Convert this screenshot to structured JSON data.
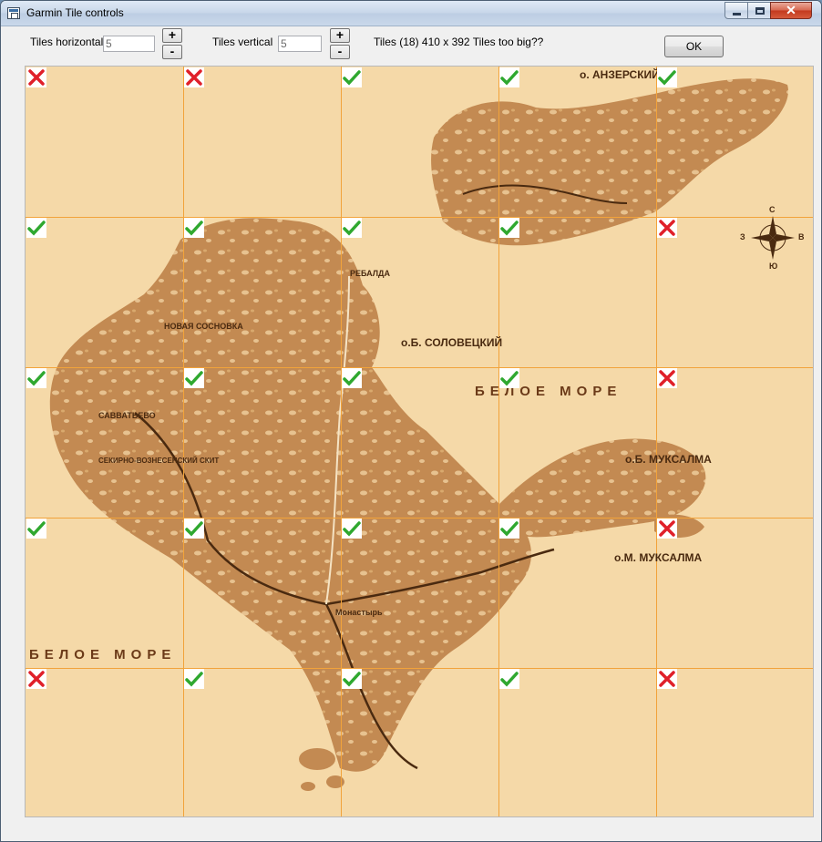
{
  "window": {
    "title": "Garmin Tile controls",
    "minimize_glyph": "",
    "close_glyph": "✕"
  },
  "controls": {
    "tiles_horizontal_label": "Tiles horizontal",
    "tiles_horizontal_value": "5",
    "tiles_vertical_label": "Tiles vertical",
    "tiles_vertical_value": "5",
    "plus": "+",
    "minus": "-",
    "info": "Tiles (18) 410 x 392  Tiles too big??",
    "ok_label": "OK"
  },
  "map": {
    "labels": {
      "anzer": "о. АНЗЕРСКИЙ",
      "solovetsky": "о.Б. СОЛОВЕЦКИЙ",
      "white_sea_1": "БЕЛОЕ МОРЕ",
      "white_sea_2": "БЕЛОЕ МОРЕ",
      "muksalma_big": "о.Б. МУКСАЛМА",
      "muksalma_small": "о.М. МУКСАЛМА",
      "savvatievo": "САВВАТЬЕВО",
      "rebalda": "РЕБАЛДА",
      "monastery": "Монастырь",
      "nov_sosnovka": "НОВАЯ СОСНОВКА",
      "sekirna": "СЕКИРНО-ВОЗНЕСЕНСКИЙ СКИТ"
    },
    "tile_status": [
      [
        "cross",
        "cross",
        "check",
        "check",
        "check"
      ],
      [
        "check",
        "check",
        "check",
        "check",
        "cross"
      ],
      [
        "check",
        "check",
        "check",
        "check",
        "cross"
      ],
      [
        "check",
        "check",
        "check",
        "check",
        "cross"
      ],
      [
        "cross",
        "check",
        "check",
        "check",
        "cross"
      ]
    ],
    "colors": {
      "sea": "#f5d9a8",
      "land": "#c38a52",
      "grid": "#f2a33a",
      "check": "#2fa82f",
      "cross": "#e0202a"
    }
  },
  "compass": {
    "n": "С",
    "s": "Ю",
    "w": "З",
    "e": "В"
  }
}
